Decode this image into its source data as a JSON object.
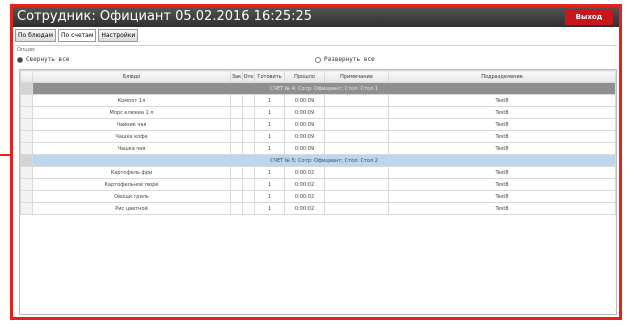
{
  "window": {
    "title": "Сотрудник: Официант 05.02.2016 16:25:25",
    "exit_label": "Выход"
  },
  "tabs": [
    {
      "label": "По блюдам",
      "active": false
    },
    {
      "label": "По счетам",
      "active": true
    },
    {
      "label": "Настройки",
      "active": false
    }
  ],
  "options": {
    "group_label": "Опции:",
    "collapse_all": {
      "label": "Свернуть все",
      "checked": true
    },
    "expand_all": {
      "label": "Развернуть все",
      "checked": false
    }
  },
  "table": {
    "columns": [
      "Блюдо",
      "Зак",
      "Отк",
      "Готовить",
      "Прошло",
      "Примечание",
      "Подразделение"
    ],
    "groups": [
      {
        "header": "СЧЕТ № 4; Сотр: Официант; Стол: Стол 1",
        "style": "gray",
        "rows": [
          {
            "dish": "Компот 1л",
            "ord": "",
            "canc": "",
            "cook": "1",
            "elapsed": "0:00:09",
            "note": "",
            "dept": "Test8"
          },
          {
            "dish": "Морс клюква 1 л",
            "ord": "",
            "canc": "",
            "cook": "1",
            "elapsed": "0:00:09",
            "note": "",
            "dept": "Test8"
          },
          {
            "dish": "Чайник чая",
            "ord": "",
            "canc": "",
            "cook": "1",
            "elapsed": "0:00:09",
            "note": "",
            "dept": "Test8"
          },
          {
            "dish": "Чашка кофе",
            "ord": "",
            "canc": "",
            "cook": "1",
            "elapsed": "0:00:09",
            "note": "",
            "dept": "Test8"
          },
          {
            "dish": "Чашка чая",
            "ord": "",
            "canc": "",
            "cook": "1",
            "elapsed": "0:00:09",
            "note": "",
            "dept": "Test8"
          }
        ]
      },
      {
        "header": "СЧЕТ № 5; Сотр: Официант; Стол: Стол 2",
        "style": "blue",
        "rows": [
          {
            "dish": "Картофель фри",
            "ord": "",
            "canc": "",
            "cook": "1",
            "elapsed": "0:00:02",
            "note": "",
            "dept": "Test8"
          },
          {
            "dish": "Картофельное пюре",
            "ord": "",
            "canc": "",
            "cook": "1",
            "elapsed": "0:00:02",
            "note": "",
            "dept": "Test8"
          },
          {
            "dish": "Овощи гриль",
            "ord": "",
            "canc": "",
            "cook": "1",
            "elapsed": "0:00:02",
            "note": "",
            "dept": "Test8"
          },
          {
            "dish": "Рис цветной",
            "ord": "",
            "canc": "",
            "cook": "1",
            "elapsed": "0:00:02",
            "note": "",
            "dept": "Test8"
          }
        ]
      }
    ]
  }
}
